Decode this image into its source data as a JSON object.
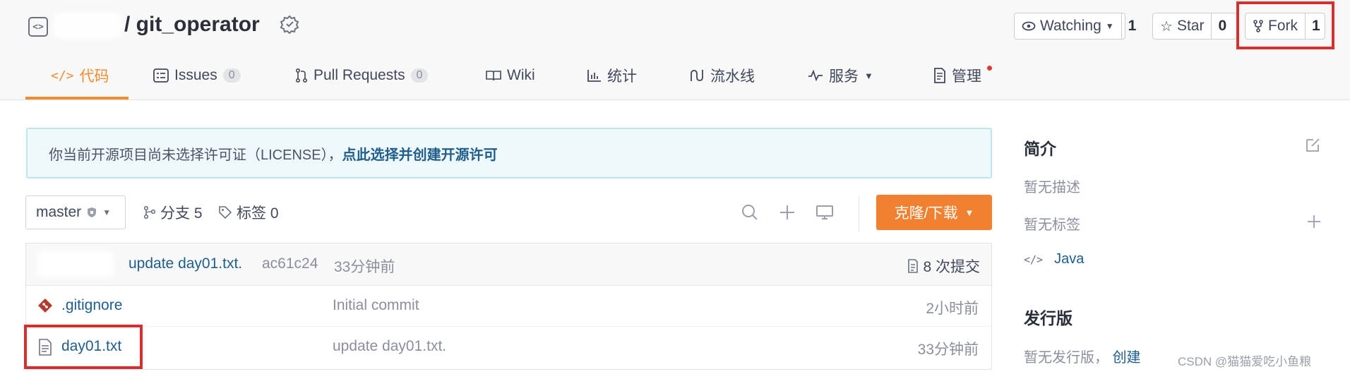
{
  "repo": {
    "name": "/ git_operator"
  },
  "header_buttons": {
    "watching": {
      "label": "Watching",
      "count": "1"
    },
    "star": {
      "label": "Star",
      "count": "0"
    },
    "fork": {
      "label": "Fork",
      "count": "1"
    }
  },
  "tabs": [
    {
      "label": "代码",
      "active": true
    },
    {
      "label": "Issues",
      "badge": "0"
    },
    {
      "label": "Pull Requests",
      "badge": "0"
    },
    {
      "label": "Wiki"
    },
    {
      "label": "统计"
    },
    {
      "label": "流水线"
    },
    {
      "label": "服务"
    },
    {
      "label": "管理"
    }
  ],
  "notice": {
    "text": "你当前开源项目尚未选择许可证（LICENSE），",
    "link": "点此选择并创建开源许可"
  },
  "branch_bar": {
    "branch": "master",
    "branches": "分支 5",
    "tags": "标签 0",
    "clone_label": "克隆/下载"
  },
  "latest_commit": {
    "message": "update day01.txt.",
    "hash": "ac61c24",
    "time": "33分钟前",
    "count": "8 次提交"
  },
  "files": [
    {
      "name": ".gitignore",
      "message": "Initial commit",
      "time": "2小时前",
      "icon": "git-icon"
    },
    {
      "name": "day01.txt",
      "message": "update day01.txt.",
      "time": "33分钟前",
      "icon": "file-icon"
    }
  ],
  "sidebar": {
    "intro_title": "简介",
    "no_description": "暂无描述",
    "no_tags": "暂无标签",
    "language": "Java",
    "releases_title": "发行版",
    "no_release": "暂无发行版，",
    "create_link": "创建"
  },
  "watermark": "CSDN @猫猫爱吃小鱼粮",
  "colors": {
    "accent": "#f18030",
    "link": "#1f5d8a",
    "highlight": "#d3312f",
    "notice_bg": "#eef8fb"
  }
}
